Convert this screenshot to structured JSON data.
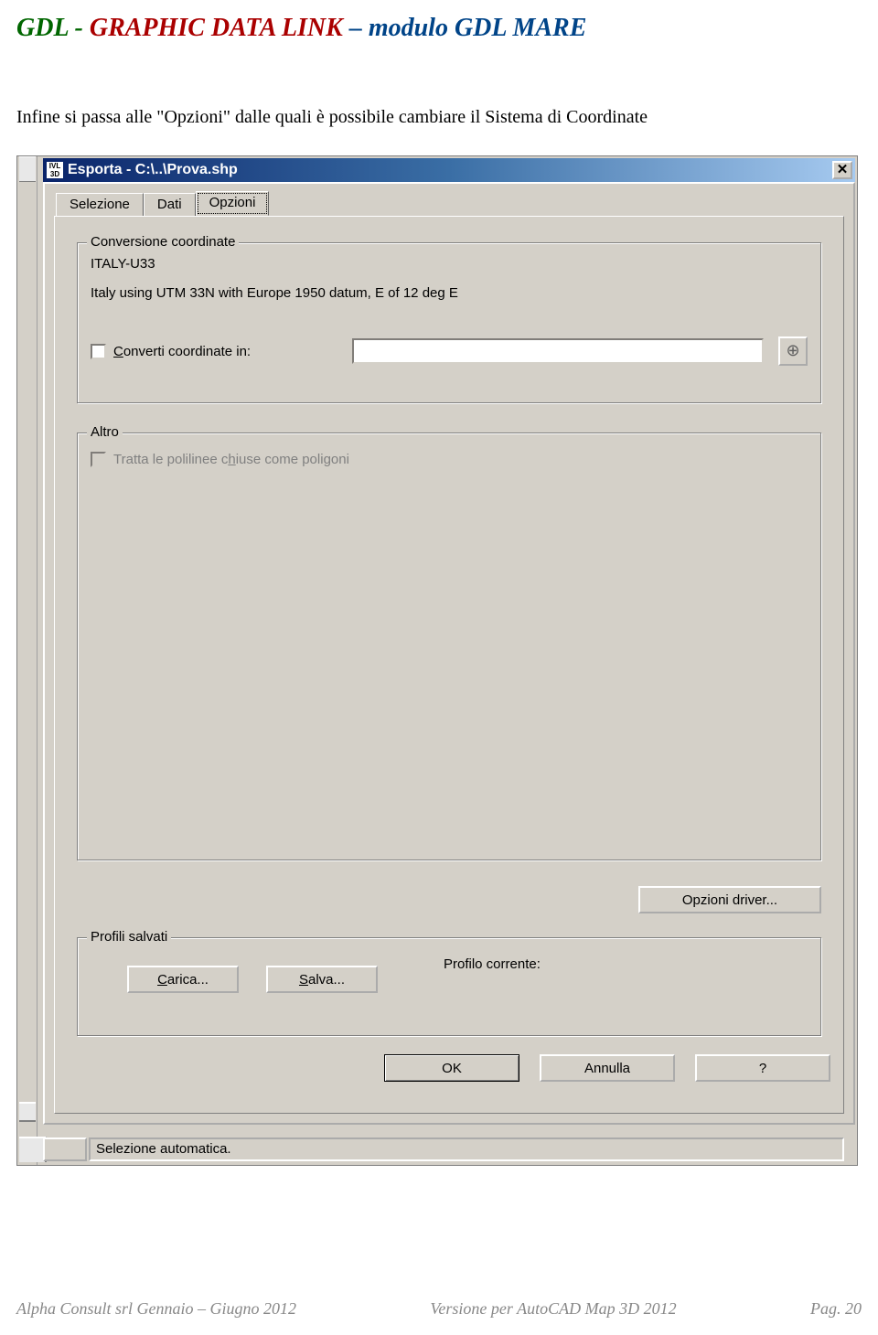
{
  "page_title": {
    "part1": "GDL - ",
    "part2": "GRAPHIC DATA LINK",
    "part3": " – modulo GDL MARE"
  },
  "body_text": "Infine si passa alle \"Opzioni\" dalle quali è possibile cambiare il Sistema di Coordinate",
  "dialog": {
    "titlebar_icon": "IVL 3D",
    "title": "Esporta - C:\\..\\Prova.shp",
    "tabs": {
      "selezione": "Selezione",
      "dati": "Dati",
      "opzioni": "Opzioni"
    },
    "conversione": {
      "legend": "Conversione coordinate",
      "name": "ITALY-U33",
      "desc": "Italy using UTM 33N with Europe 1950 datum, E of 12 deg E",
      "check_label_pre": "C",
      "check_label_post": "onverti coordinate in:"
    },
    "altro": {
      "legend": "Altro",
      "poly_pre": "Tratta le polilinee c",
      "poly_u": "h",
      "poly_post": "iuse come poligoni"
    },
    "driver_btn": "Opzioni driver...",
    "profili": {
      "legend": "Profili salvati",
      "carica": "Carica...",
      "salva": "Salva...",
      "corrente": "Profilo corrente:"
    },
    "ok": "OK",
    "annulla": "Annulla",
    "help": "?",
    "status": "Selezione automatica."
  },
  "footer": {
    "left": "Alpha Consult srl Gennaio – Giugno 2012",
    "center": "Versione per AutoCAD Map 3D 2012",
    "right": "Pag. 20"
  }
}
